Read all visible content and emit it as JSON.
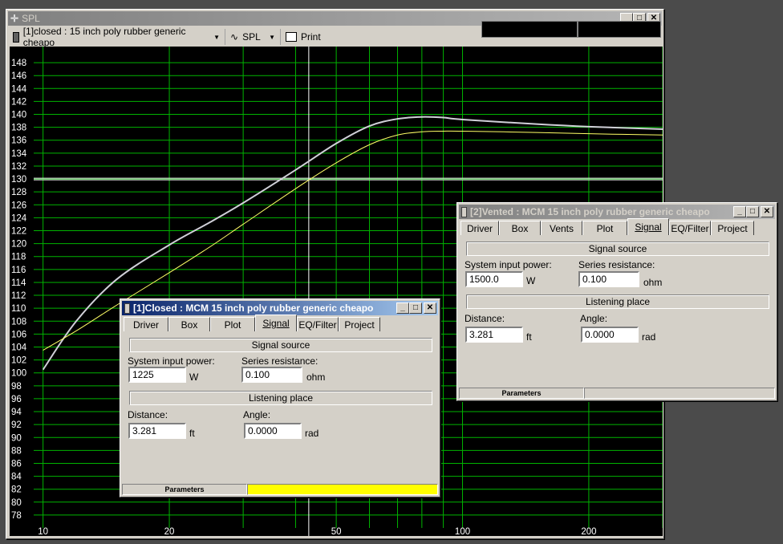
{
  "main_window": {
    "title": "SPL",
    "toolbar": {
      "project_select": "[1]closed : 15 inch poly rubber generic cheapo",
      "view_select": "SPL",
      "print_label": "Print"
    }
  },
  "chart_data": {
    "type": "line",
    "xscale": "log",
    "xlim": [
      9.5,
      300
    ],
    "ylim": [
      76.5,
      149.5
    ],
    "x_ticks": [
      10,
      20,
      50,
      100,
      200
    ],
    "y_ticks": [
      78,
      80,
      82,
      84,
      86,
      88,
      90,
      92,
      94,
      96,
      98,
      100,
      102,
      104,
      106,
      108,
      110,
      112,
      114,
      116,
      118,
      120,
      122,
      124,
      126,
      128,
      130,
      132,
      134,
      136,
      138,
      140,
      142,
      144,
      146,
      148
    ],
    "grid": true,
    "cursor": {
      "x": 43,
      "y": 130
    },
    "series": [
      {
        "color": "#d0d0d8",
        "x": [
          10,
          12,
          15,
          20,
          25,
          30,
          40,
          50,
          60,
          70,
          80,
          90,
          100,
          150,
          200,
          300
        ],
        "y": [
          100.5,
          108,
          114.5,
          119.8,
          123.3,
          126.3,
          131.4,
          135.5,
          138.2,
          139.3,
          139.6,
          139.5,
          139.2,
          138.5,
          138.1,
          137.7
        ]
      },
      {
        "color": "#ffff66",
        "x": [
          10,
          12,
          15,
          20,
          25,
          30,
          40,
          50,
          60,
          70,
          80,
          90,
          100,
          150,
          200,
          300
        ],
        "y": [
          103.5,
          106.5,
          110.5,
          115.5,
          119.5,
          123,
          128.5,
          132.5,
          135.3,
          136.8,
          137.3,
          137.4,
          137.4,
          137.2,
          137,
          136.8
        ]
      }
    ]
  },
  "closed_window": {
    "title": "[1]Closed : MCM 15 inch poly rubber generic cheapo",
    "tabs": [
      "Driver",
      "Box",
      "Plot",
      "Signal",
      "EQ/Filter",
      "Project"
    ],
    "active_tab": "Signal",
    "signal_source_header": "Signal source",
    "input_power_label": "System input power:",
    "input_power_value": "1225",
    "input_power_unit": "W",
    "series_res_label": "Series resistance:",
    "series_res_value": "0.100",
    "series_res_unit": "ohm",
    "listening_header": "Listening place",
    "distance_label": "Distance:",
    "distance_value": "3.281",
    "distance_unit": "ft",
    "angle_label": "Angle:",
    "angle_value": "0.0000",
    "angle_unit": "rad",
    "status_left": "Parameters",
    "status_right_color": "#ffff00"
  },
  "vented_window": {
    "title": "[2]Vented : MCM 15 inch poly rubber generic cheapo",
    "tabs": [
      "Driver",
      "Box",
      "Vents",
      "Plot",
      "Signal",
      "EQ/Filter",
      "Project"
    ],
    "active_tab": "Signal",
    "signal_source_header": "Signal source",
    "input_power_label": "System input power:",
    "input_power_value": "1500.0",
    "input_power_unit": "W",
    "series_res_label": "Series resistance:",
    "series_res_value": "0.100",
    "series_res_unit": "ohm",
    "listening_header": "Listening place",
    "distance_label": "Distance:",
    "distance_value": "3.281",
    "distance_unit": "ft",
    "angle_label": "Angle:",
    "angle_value": "0.0000",
    "angle_unit": "rad",
    "status_left": "Parameters"
  }
}
